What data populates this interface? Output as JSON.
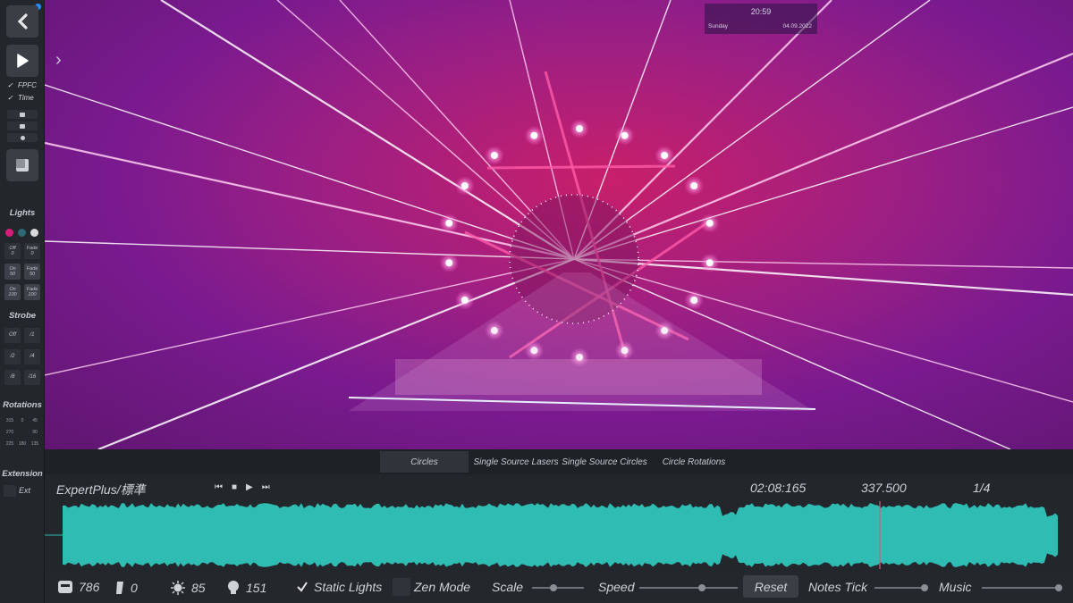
{
  "sidebar": {
    "checks": [
      {
        "label": "FPFC",
        "checked": true
      },
      {
        "label": "Time",
        "checked": true
      }
    ],
    "lights_title": "Lights",
    "light_colors": [
      "#d81b78",
      "#2e6a74",
      "#d9d9d9"
    ],
    "lights_buttons": [
      {
        "top": "Off",
        "bottom": "0"
      },
      {
        "top": "Fade",
        "bottom": "0"
      },
      {
        "top": "On",
        "bottom": "50"
      },
      {
        "top": "Fade",
        "bottom": "50"
      },
      {
        "top": "On",
        "bottom": "100"
      },
      {
        "top": "Fade",
        "bottom": "100"
      }
    ],
    "strobe_title": "Strobe",
    "strobe_buttons": [
      "Off",
      "/1",
      "/2",
      "/4",
      "/8",
      "/16"
    ],
    "rotations_title": "Rotations",
    "rotations": [
      "315",
      "0",
      "45",
      "270",
      "",
      "90",
      "225",
      "180",
      "135"
    ],
    "extension_title": "Extension",
    "ext_label": "Ext"
  },
  "viewport": {
    "clock_time": "20:59",
    "clock_day": "Sunday",
    "clock_date": "04.09.2022"
  },
  "tabs": [
    {
      "label": "Circles",
      "active": true
    },
    {
      "label": "Single Source Lasers",
      "active": false
    },
    {
      "label": "Single Source Circles",
      "active": false
    },
    {
      "label": "Circle Rotations",
      "active": false
    }
  ],
  "timeline": {
    "difficulty": "ExpertPlus/標準",
    "time": "02:08:165",
    "beat": "337.500",
    "precision": "1/4",
    "waveform_color": "#2ebcb3",
    "playhead_color": "#e05a7a"
  },
  "bottombar": {
    "notes_count": "786",
    "walls_count": "0",
    "bombs_count": "85",
    "lights_count": "151",
    "static_lights_label": "Static Lights",
    "static_lights_checked": true,
    "zen_mode_label": "Zen Mode",
    "scale_label": "Scale",
    "speed_label": "Speed",
    "reset_label": "Reset",
    "notes_tick_label": "Notes Tick",
    "music_label": "Music"
  }
}
